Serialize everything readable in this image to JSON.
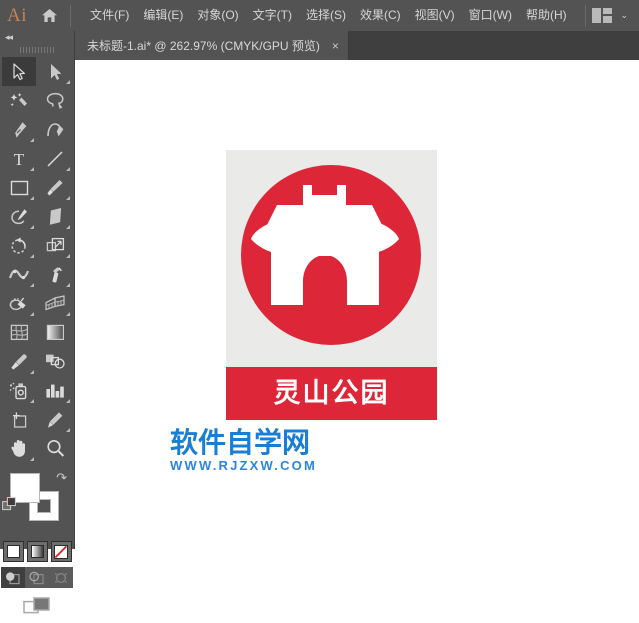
{
  "app": {
    "logo_text": "Ai",
    "home_icon": "home-icon",
    "workspace_icon": "workspace-switcher-icon",
    "chevron": "⌄"
  },
  "menubar": {
    "items": [
      {
        "label": "文件(F)",
        "name": "menu-file"
      },
      {
        "label": "编辑(E)",
        "name": "menu-edit"
      },
      {
        "label": "对象(O)",
        "name": "menu-object"
      },
      {
        "label": "文字(T)",
        "name": "menu-type"
      },
      {
        "label": "选择(S)",
        "name": "menu-select"
      },
      {
        "label": "效果(C)",
        "name": "menu-effect"
      },
      {
        "label": "视图(V)",
        "name": "menu-view"
      },
      {
        "label": "窗口(W)",
        "name": "menu-window"
      },
      {
        "label": "帮助(H)",
        "name": "menu-help"
      }
    ]
  },
  "tabs": {
    "documents": [
      {
        "title": "未标题-1.ai* @ 262.97% (CMYK/GPU 预览)",
        "close_label": "×",
        "active": true
      }
    ]
  },
  "toolbar": {
    "collapse_label": "◂◂",
    "tools": [
      {
        "name": "selection-tool",
        "active": true,
        "corner": false
      },
      {
        "name": "direct-selection-tool",
        "active": false,
        "corner": true
      },
      {
        "name": "magic-wand-tool",
        "active": false,
        "corner": false
      },
      {
        "name": "lasso-tool",
        "active": false,
        "corner": false
      },
      {
        "name": "pen-tool",
        "active": false,
        "corner": true
      },
      {
        "name": "curvature-tool",
        "active": false,
        "corner": false
      },
      {
        "name": "type-tool",
        "active": false,
        "corner": true
      },
      {
        "name": "line-segment-tool",
        "active": false,
        "corner": true
      },
      {
        "name": "rectangle-tool",
        "active": false,
        "corner": true
      },
      {
        "name": "paintbrush-tool",
        "active": false,
        "corner": true
      },
      {
        "name": "shaper-tool",
        "active": false,
        "corner": true
      },
      {
        "name": "eraser-tool",
        "active": false,
        "corner": true
      },
      {
        "name": "rotate-tool",
        "active": false,
        "corner": true
      },
      {
        "name": "scale-tool",
        "active": false,
        "corner": true
      },
      {
        "name": "width-tool",
        "active": false,
        "corner": true
      },
      {
        "name": "free-transform-tool",
        "active": false,
        "corner": true
      },
      {
        "name": "shape-builder-tool",
        "active": false,
        "corner": true
      },
      {
        "name": "perspective-grid-tool",
        "active": false,
        "corner": true
      },
      {
        "name": "mesh-tool",
        "active": false,
        "corner": false
      },
      {
        "name": "gradient-tool",
        "active": false,
        "corner": false
      },
      {
        "name": "eyedropper-tool",
        "active": false,
        "corner": true
      },
      {
        "name": "blend-tool",
        "active": false,
        "corner": false
      },
      {
        "name": "symbol-sprayer-tool",
        "active": false,
        "corner": true
      },
      {
        "name": "column-graph-tool",
        "active": false,
        "corner": true
      },
      {
        "name": "artboard-tool",
        "active": false,
        "corner": false
      },
      {
        "name": "slice-tool",
        "active": false,
        "corner": true
      },
      {
        "name": "hand-tool",
        "active": false,
        "corner": true
      },
      {
        "name": "zoom-tool",
        "active": false,
        "corner": false
      }
    ],
    "fill_color": "#FFFFFF",
    "stroke_color": "#FFFFFF",
    "swap_icon": "swap-fill-stroke-icon",
    "defaults_icon": "default-fill-stroke-icon",
    "mode_buttons": [
      {
        "name": "color-mode-button",
        "active": true
      },
      {
        "name": "gradient-mode-button",
        "active": false
      },
      {
        "name": "none-mode-button",
        "active": false
      }
    ],
    "draw_buttons": [
      {
        "name": "draw-normal-button",
        "active": true
      },
      {
        "name": "draw-behind-button",
        "active": false
      },
      {
        "name": "draw-inside-button",
        "active": false
      }
    ],
    "screen_mode": {
      "name": "change-screen-mode-button"
    }
  },
  "canvas": {
    "background": "#FFFFFF",
    "artwork": {
      "name": "park-logo-artwork",
      "panel_color": "#EAEAE9",
      "circle_color": "#DD2739",
      "gate_color": "#FFFFFF",
      "banner_color": "#DD2739",
      "banner_text": "灵山公园",
      "banner_text_color": "#FFFFFF",
      "gate_icon": "chinese-gate-tower-icon"
    },
    "watermark": {
      "name": "site-watermark",
      "main": "软件自学网",
      "sub": "WWW.RJZXW.COM",
      "color": "#1A7FD4"
    }
  }
}
